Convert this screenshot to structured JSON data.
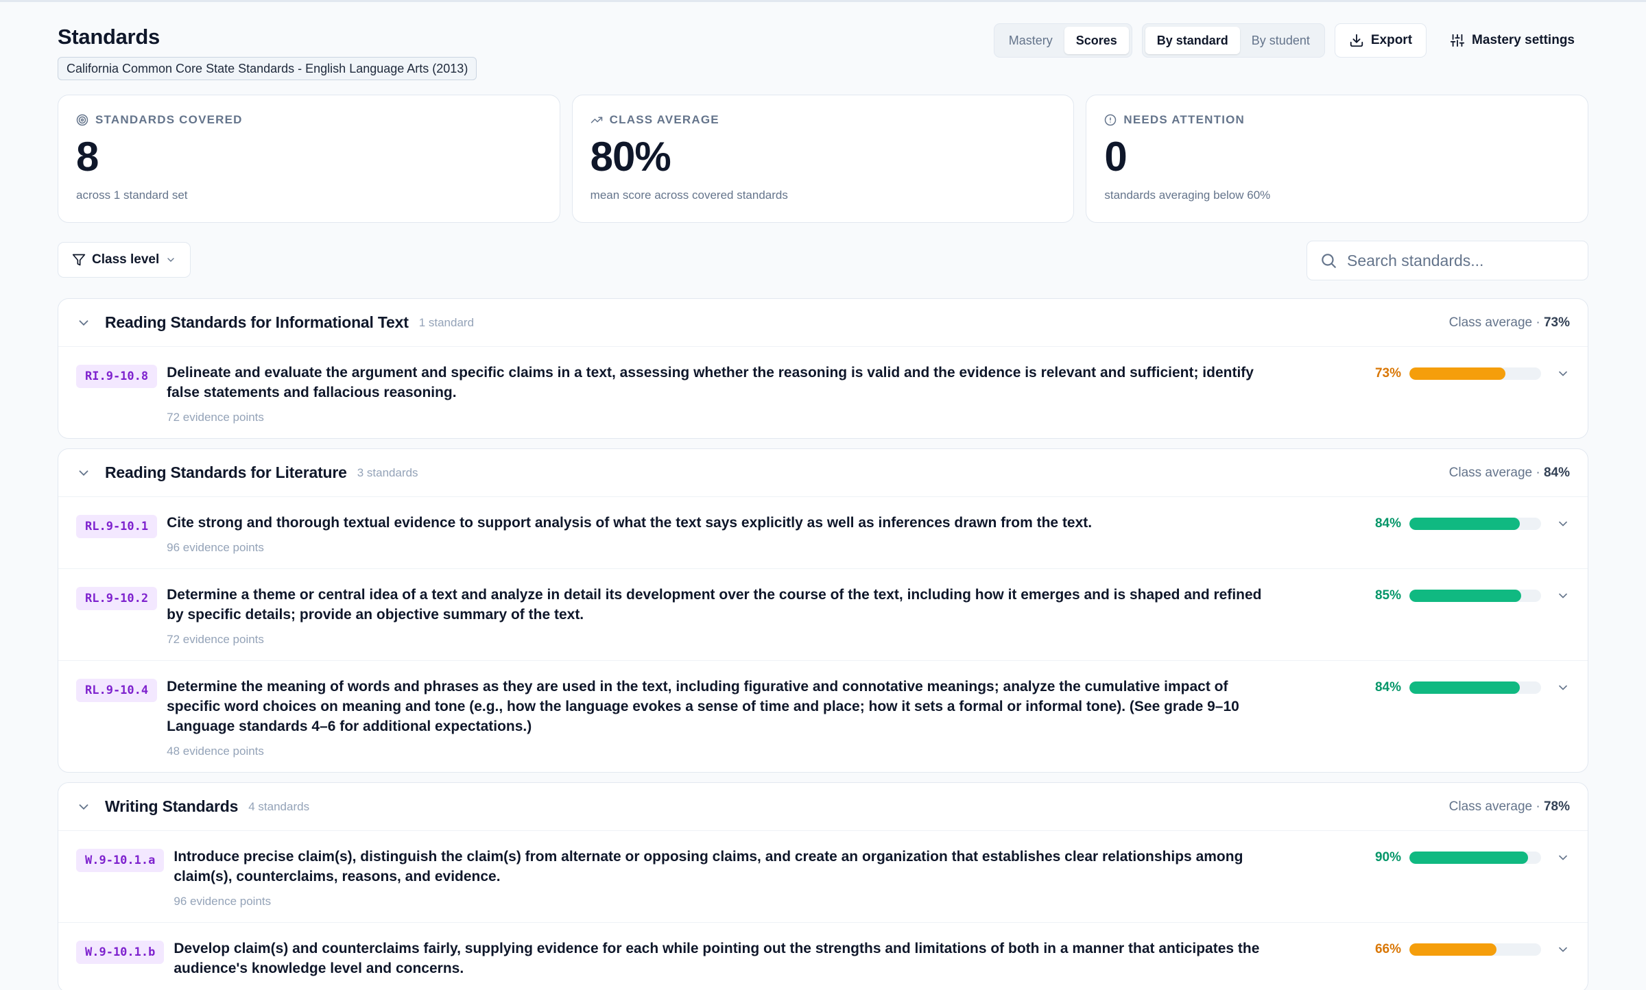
{
  "header": {
    "title": "Standards",
    "standard_set": "California Common Core State Standards - English Language Arts (2013)",
    "mode_toggle": {
      "mastery": "Mastery",
      "scores": "Scores",
      "active": "scores"
    },
    "view_toggle": {
      "by_standard": "By standard",
      "by_student": "By student",
      "active": "by_standard"
    },
    "export_label": "Export",
    "settings_label": "Mastery settings"
  },
  "stats": {
    "covered": {
      "label": "STANDARDS COVERED",
      "value": "8",
      "sub": "across 1 standard set",
      "icon": "target-icon"
    },
    "average": {
      "label": "CLASS AVERAGE",
      "value": "80%",
      "sub": "mean score across covered standards",
      "icon": "trend-up-icon"
    },
    "attention": {
      "label": "NEEDS ATTENTION",
      "value": "0",
      "sub": "standards averaging below 60%",
      "icon": "alert-circle-icon"
    }
  },
  "filters": {
    "class_level_label": "Class level",
    "search_placeholder": "Search standards..."
  },
  "colors": {
    "good": "#10b981",
    "good_text": "#059669",
    "warn": "#f59e0b",
    "warn_text": "#d97706",
    "code_bg": "#f3e8ff",
    "code_text": "#7e22ce"
  },
  "groups": [
    {
      "title": "Reading Standards for Informational Text",
      "count": "1 standard",
      "avg_label": "Class average · ",
      "avg_value": "73%",
      "standards": [
        {
          "code": "RI.9-10.8",
          "description": "Delineate and evaluate the argument and specific claims in a text, assessing whether the reasoning is valid and the evidence is relevant and sufficient; identify false statements and fallacious reasoning.",
          "evidence": "72 evidence points",
          "pct_label": "73%",
          "score": 73
        }
      ]
    },
    {
      "title": "Reading Standards for Literature",
      "count": "3 standards",
      "avg_label": "Class average · ",
      "avg_value": "84%",
      "standards": [
        {
          "code": "RL.9-10.1",
          "description": "Cite strong and thorough textual evidence to support analysis of what the text says explicitly as well as inferences drawn from the text.",
          "evidence": "96 evidence points",
          "pct_label": "84%",
          "score": 84
        },
        {
          "code": "RL.9-10.2",
          "description": "Determine a theme or central idea of a text and analyze in detail its development over the course of the text, including how it emerges and is shaped and refined by specific details; provide an objective summary of the text.",
          "evidence": "72 evidence points",
          "pct_label": "85%",
          "score": 85
        },
        {
          "code": "RL.9-10.4",
          "description": "Determine the meaning of words and phrases as they are used in the text, including figurative and connotative meanings; analyze the cumulative impact of specific word choices on meaning and tone (e.g., how the language evokes a sense of time and place; how it sets a formal or informal tone). (See grade 9–10 Language standards 4–6 for additional expectations.)",
          "evidence": "48 evidence points",
          "pct_label": "84%",
          "score": 84
        }
      ]
    },
    {
      "title": "Writing Standards",
      "count": "4 standards",
      "avg_label": "Class average · ",
      "avg_value": "78%",
      "standards": [
        {
          "code": "W.9-10.1.a",
          "description": "Introduce precise claim(s), distinguish the claim(s) from alternate or opposing claims, and create an organization that establishes clear relationships among claim(s), counterclaims, reasons, and evidence.",
          "evidence": "96 evidence points",
          "pct_label": "90%",
          "score": 90
        },
        {
          "code": "W.9-10.1.b",
          "description": "Develop claim(s) and counterclaims fairly, supplying evidence for each while pointing out the strengths and limitations of both in a manner that anticipates the audience's knowledge level and concerns.",
          "evidence": "",
          "pct_label": "66%",
          "score": 66
        }
      ]
    }
  ]
}
